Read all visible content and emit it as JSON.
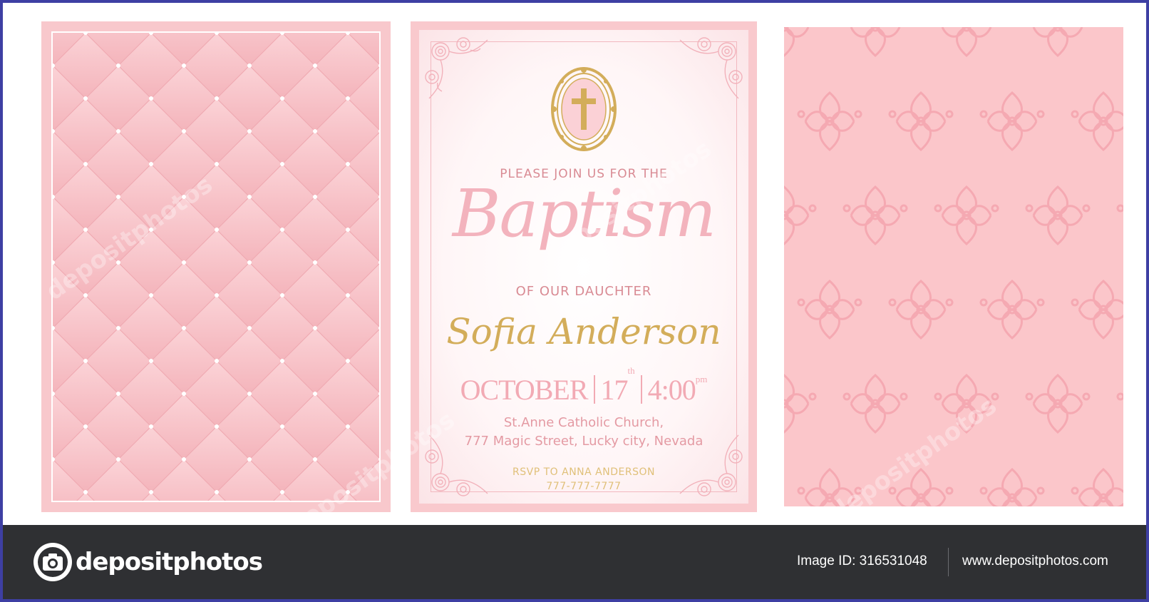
{
  "invitation": {
    "intro": "PLEASE JOIN US FOR THE",
    "title": "Baptism",
    "relation": "OF OUR DAUCHTER",
    "name": "Sofia Anderson",
    "month": "OCTOBER",
    "day": "17",
    "day_suffix": "th",
    "time": "4:00",
    "time_suffix": "pm",
    "church": "St.Anne Catholic Church,",
    "address": "777 Magic Street, Lucky city, Nevada",
    "rsvp": "RSVP TO ANNA ANDERSON",
    "phone": "777-777-7777"
  },
  "watermark": "depositphotos",
  "footer": {
    "brand": "depositphotos",
    "image_id": "Image ID: 316531048",
    "site": "www.depositphotos.com"
  },
  "colors": {
    "pink": "#f8c8cc",
    "gold": "#d3ad5a",
    "footer_bg": "#2f3033",
    "border": "#3e3fa3"
  },
  "icons": {
    "cross": "cross-icon",
    "camera": "camera-icon"
  }
}
